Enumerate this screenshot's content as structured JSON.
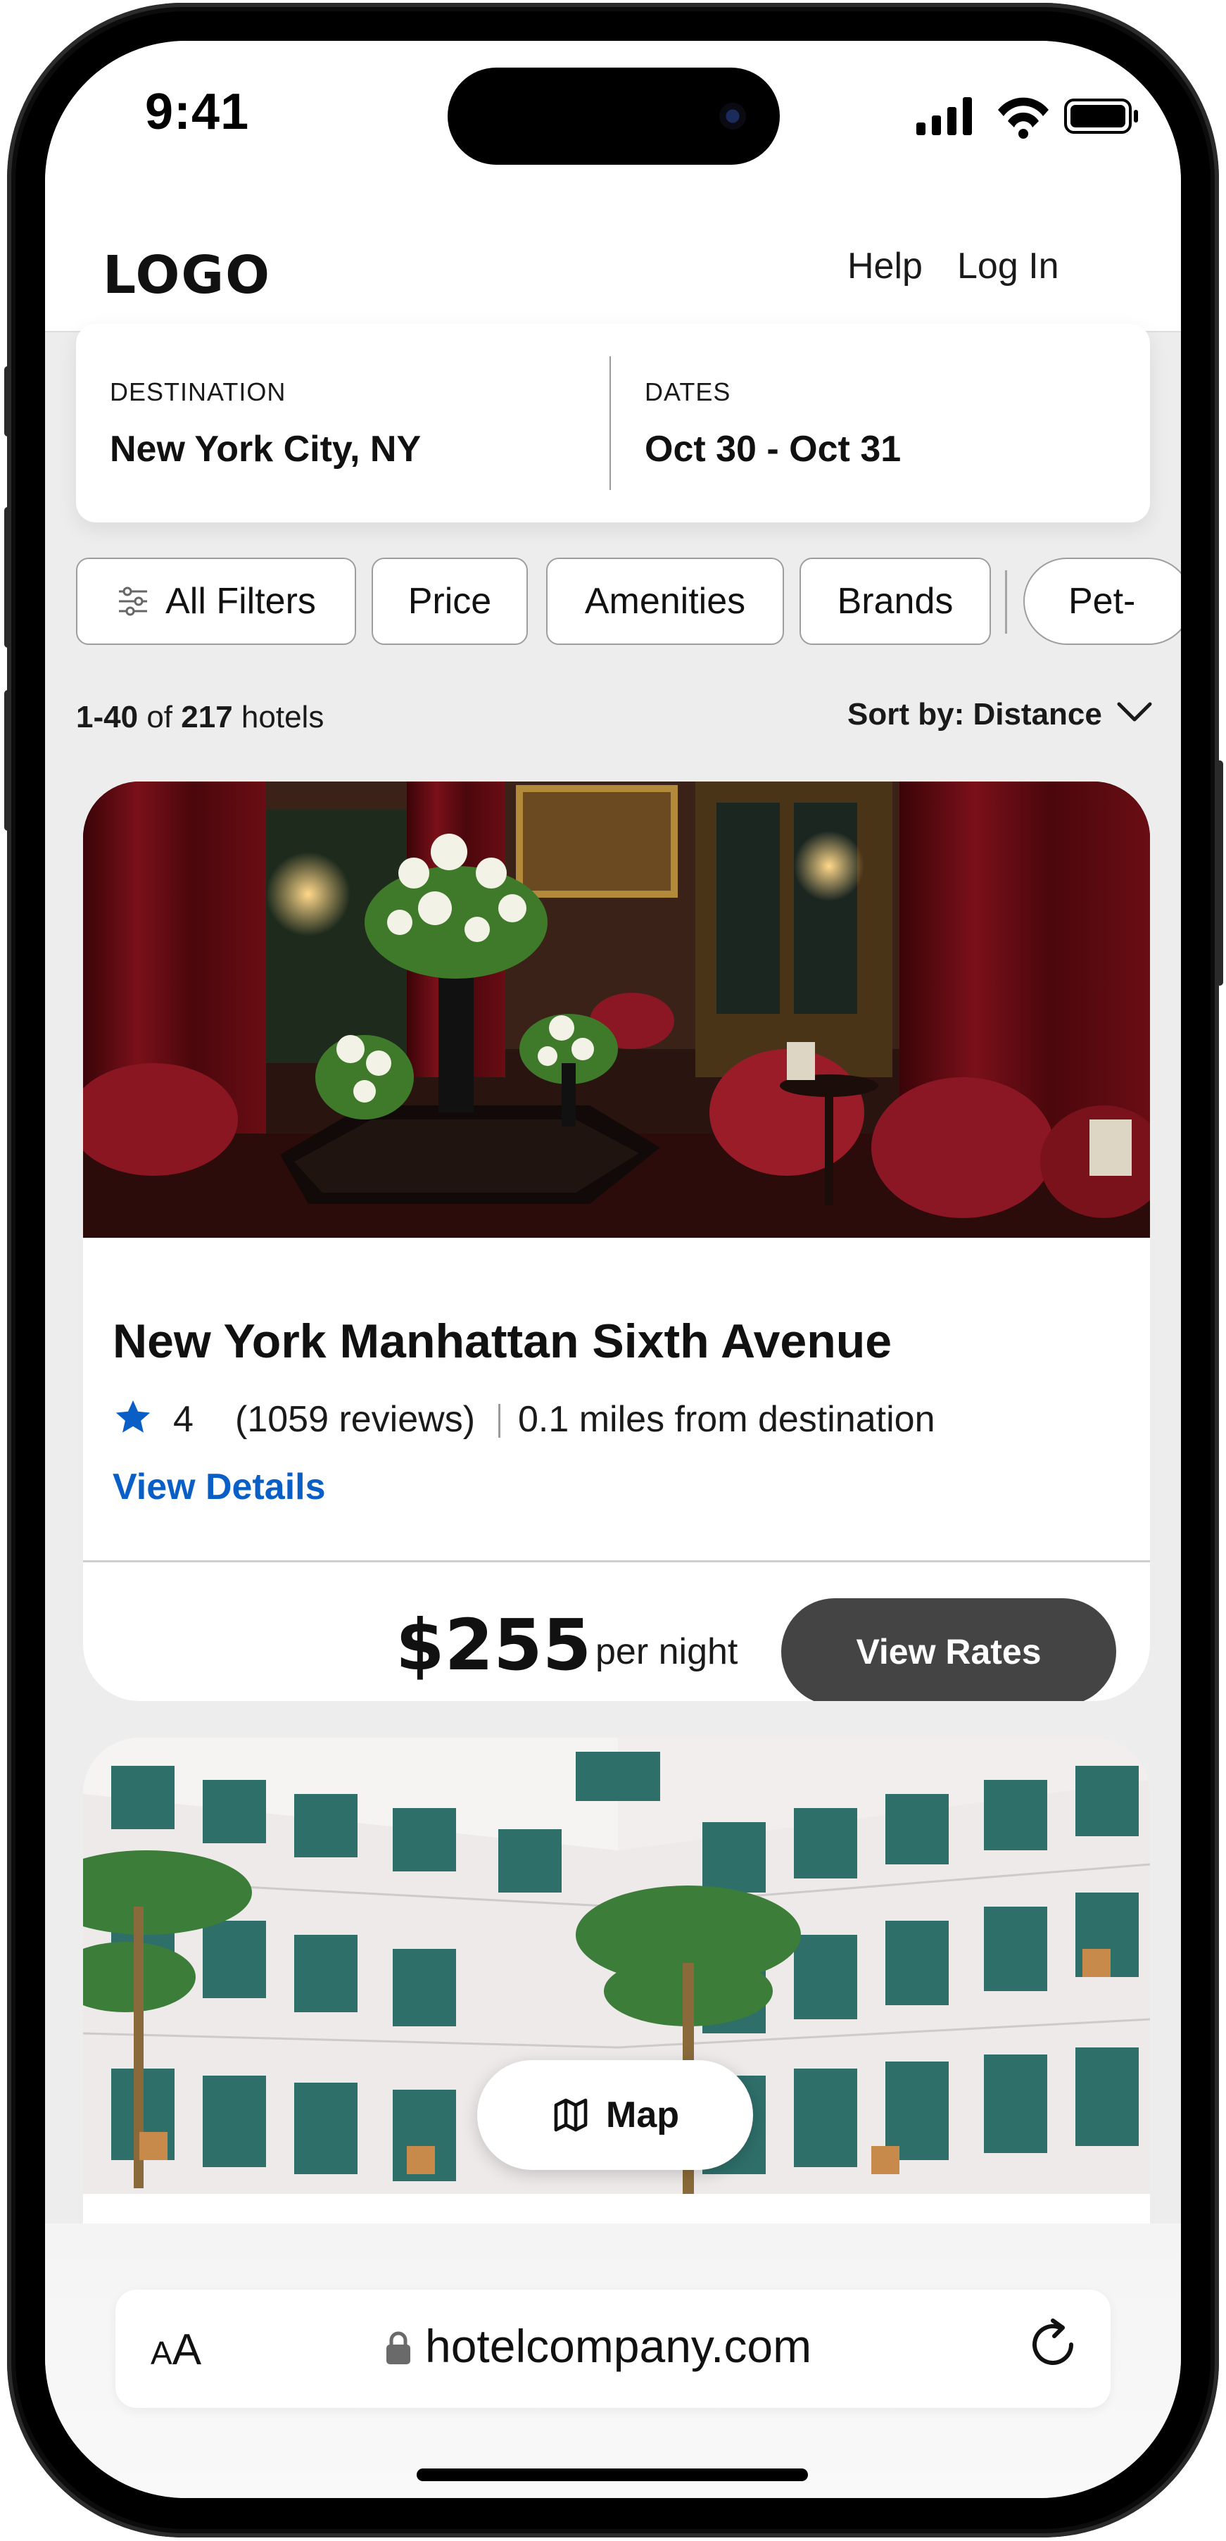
{
  "status_bar": {
    "time": "9:41"
  },
  "header": {
    "logo": "LOGO",
    "help_label": "Help",
    "login_label": "Log In"
  },
  "search": {
    "destination_label": "DESTINATION",
    "destination_value": "New York City, NY",
    "dates_label": "DATES",
    "dates_value": "Oct 30 - Oct 31"
  },
  "filters": {
    "all_filters": "All Filters",
    "price": "Price",
    "amenities": "Amenities",
    "brands": "Brands",
    "pet": "Pet-"
  },
  "results": {
    "range": "1-40",
    "of": "of",
    "total": "217",
    "unit": "hotels",
    "sort_label": "Sort by: Distance"
  },
  "hotels": [
    {
      "name": "New York Manhattan Sixth Avenue",
      "rating": "4",
      "reviews": "(1059 reviews)",
      "distance": "0.1 miles from destination",
      "view_details": "View Details",
      "price": "$255",
      "price_unit": "per night",
      "view_rates": "View Rates"
    }
  ],
  "map_button": {
    "label": "Map"
  },
  "browser": {
    "text_size": "AA",
    "url": "hotelcompany.com"
  },
  "colors": {
    "accent": "#0a5fc7",
    "button_dark": "#444444"
  }
}
